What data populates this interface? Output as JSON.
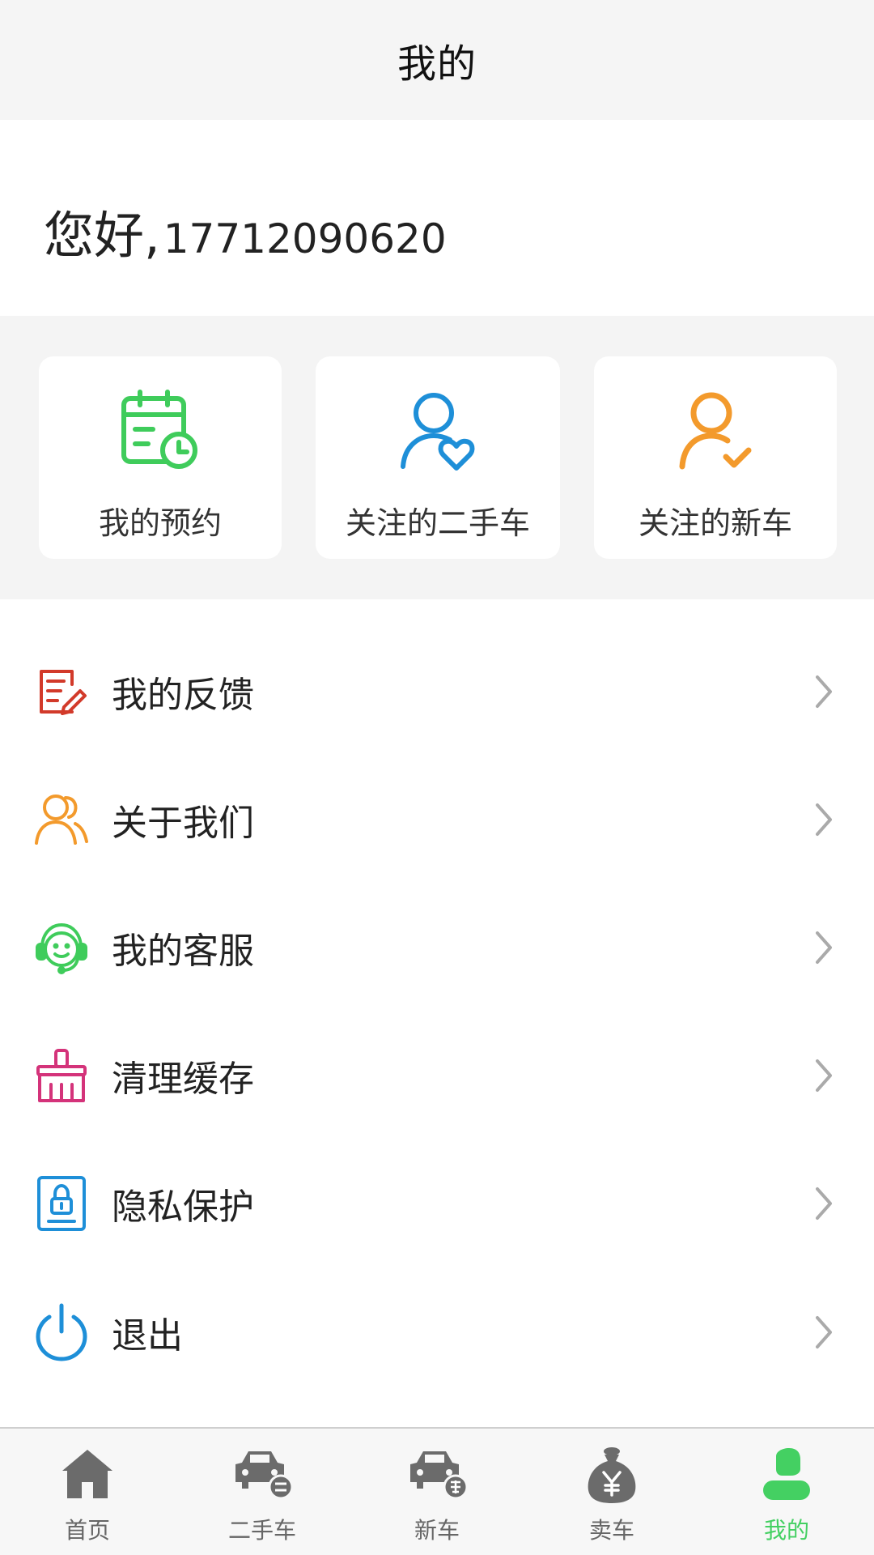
{
  "header": {
    "title": "我的"
  },
  "greeting": {
    "hello": "您好,",
    "phone": "17712090620"
  },
  "quick_actions": [
    {
      "label": "我的预约",
      "icon": "calendar-clock-icon",
      "color": "#3fcc5b"
    },
    {
      "label": "关注的二手车",
      "icon": "user-heart-icon",
      "color": "#1e8fd8"
    },
    {
      "label": "关注的新车",
      "icon": "user-check-icon",
      "color": "#f39a2c"
    }
  ],
  "menu": [
    {
      "label": "我的反馈",
      "icon": "feedback-edit-icon",
      "color": "#d23a2a"
    },
    {
      "label": "关于我们",
      "icon": "users-icon",
      "color": "#f39a2c"
    },
    {
      "label": "我的客服",
      "icon": "headset-smile-icon",
      "color": "#3fcc5b"
    },
    {
      "label": "清理缓存",
      "icon": "brush-icon",
      "color": "#d4337a"
    },
    {
      "label": "隐私保护",
      "icon": "privacy-lock-icon",
      "color": "#1e8fd8"
    },
    {
      "label": "退出",
      "icon": "power-icon",
      "color": "#1e8fd8"
    }
  ],
  "tabbar": {
    "active_color": "#44d062",
    "items": [
      {
        "label": "首页",
        "icon": "home-icon"
      },
      {
        "label": "二手车",
        "icon": "used-car-icon"
      },
      {
        "label": "新车",
        "icon": "new-car-icon"
      },
      {
        "label": "卖车",
        "icon": "money-bag-icon"
      },
      {
        "label": "我的",
        "icon": "person-icon",
        "active": true
      }
    ]
  }
}
